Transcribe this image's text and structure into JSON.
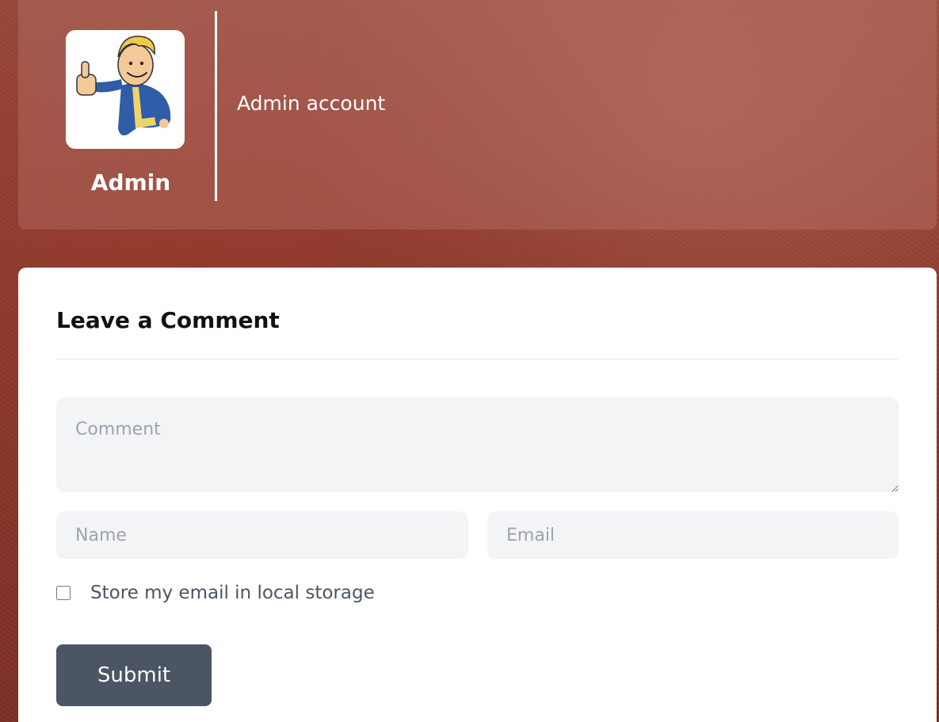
{
  "author": {
    "name": "Admin",
    "bio": "Admin account",
    "avatar_icon": "vault-boy-thumbs-up-icon"
  },
  "comment_form": {
    "title": "Leave a Comment",
    "comment_placeholder": "Comment",
    "name_placeholder": "Name",
    "email_placeholder": "Email",
    "store_email_label": "Store my email in local storage",
    "store_email_checked": false,
    "submit_label": "Submit"
  },
  "colors": {
    "background": "#8d3a2c",
    "card_overlay": "#c88c82",
    "field_background": "#f3f4f6",
    "submit_background": "#4b5563",
    "placeholder": "#9ca3af"
  }
}
